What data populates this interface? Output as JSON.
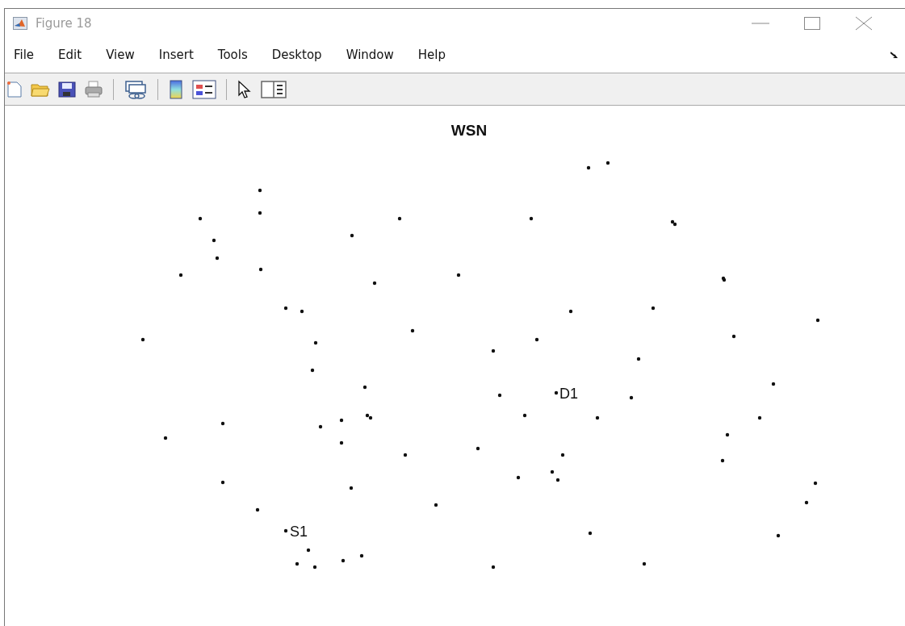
{
  "window": {
    "title": "Figure 18"
  },
  "menu": [
    "File",
    "Edit",
    "View",
    "Insert",
    "Tools",
    "Desktop",
    "Window",
    "Help"
  ],
  "plot": {
    "title": "WSN",
    "labels": [
      {
        "text": "D1",
        "kind": "destination"
      },
      {
        "text": "S1",
        "kind": "source"
      }
    ]
  }
}
